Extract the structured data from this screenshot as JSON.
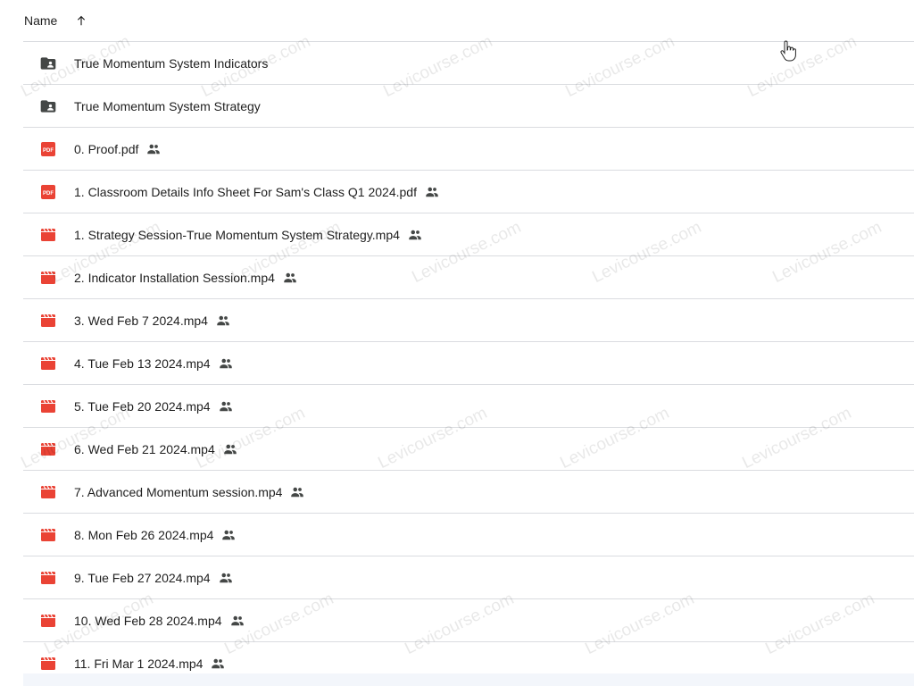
{
  "header": {
    "name_label": "Name",
    "sort_icon": "arrow-upward-icon"
  },
  "files": [
    {
      "name": "True Momentum System Indicators",
      "type": "shared-folder",
      "icon": "shared-folder-icon",
      "shared": false
    },
    {
      "name": "True Momentum System Strategy",
      "type": "shared-folder",
      "icon": "shared-folder-icon",
      "shared": false
    },
    {
      "name": "0. Proof.pdf",
      "type": "pdf",
      "icon": "pdf-icon",
      "shared": true
    },
    {
      "name": "1. Classroom Details Info Sheet For Sam's Class Q1 2024.pdf",
      "type": "pdf",
      "icon": "pdf-icon",
      "shared": true
    },
    {
      "name": "1. Strategy Session-True Momentum System Strategy.mp4",
      "type": "video",
      "icon": "video-icon",
      "shared": true
    },
    {
      "name": "2. Indicator Installation Session.mp4",
      "type": "video",
      "icon": "video-icon",
      "shared": true
    },
    {
      "name": "3. Wed Feb 7 2024.mp4",
      "type": "video",
      "icon": "video-icon",
      "shared": true
    },
    {
      "name": "4. Tue Feb 13 2024.mp4",
      "type": "video",
      "icon": "video-icon",
      "shared": true
    },
    {
      "name": "5. Tue Feb 20 2024.mp4",
      "type": "video",
      "icon": "video-icon",
      "shared": true
    },
    {
      "name": "6. Wed Feb 21 2024.mp4",
      "type": "video",
      "icon": "video-icon",
      "shared": true
    },
    {
      "name": "7. Advanced Momentum session.mp4",
      "type": "video",
      "icon": "video-icon",
      "shared": true
    },
    {
      "name": "8. Mon Feb 26 2024.mp4",
      "type": "video",
      "icon": "video-icon",
      "shared": true
    },
    {
      "name": "9. Tue Feb 27 2024.mp4",
      "type": "video",
      "icon": "video-icon",
      "shared": true
    },
    {
      "name": "10. Wed Feb 28 2024.mp4",
      "type": "video",
      "icon": "video-icon",
      "shared": true
    },
    {
      "name": "11. Fri Mar 1 2024.mp4",
      "type": "video",
      "icon": "video-icon",
      "shared": true
    }
  ],
  "shared_icon": "people-icon",
  "watermark": "Levicourse.com",
  "colors": {
    "pdf": "#ea4335",
    "video": "#ea4335",
    "folder": "#444746",
    "divider": "#dadce0"
  }
}
